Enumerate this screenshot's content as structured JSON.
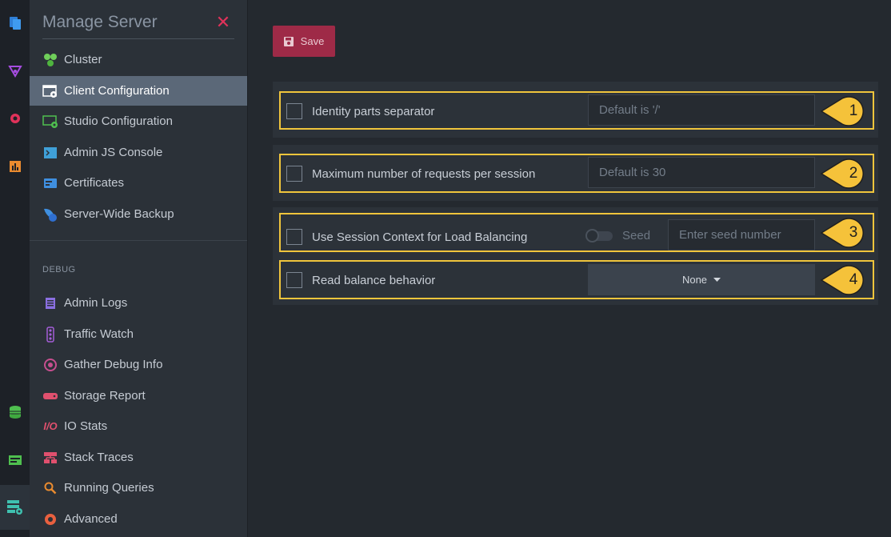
{
  "menu": {
    "title": "Manage Server",
    "items": [
      {
        "label": "Cluster"
      },
      {
        "label": "Client Configuration"
      },
      {
        "label": "Studio Configuration"
      },
      {
        "label": "Admin JS Console"
      },
      {
        "label": "Certificates"
      },
      {
        "label": "Server-Wide Backup"
      }
    ],
    "debug_section": "DEBUG",
    "debug_items": [
      {
        "label": "Admin Logs"
      },
      {
        "label": "Traffic Watch"
      },
      {
        "label": "Gather Debug Info"
      },
      {
        "label": "Storage Report"
      },
      {
        "label": "IO Stats"
      },
      {
        "label": "Stack Traces"
      },
      {
        "label": "Running Queries"
      },
      {
        "label": "Advanced"
      }
    ]
  },
  "toolbar": {
    "save_label": "Save"
  },
  "settings": {
    "identity": {
      "label": "Identity parts separator",
      "placeholder": "Default is '/'",
      "callout": "1"
    },
    "max_requests": {
      "label": "Maximum number of requests per session",
      "placeholder": "Default is 30",
      "callout": "2"
    },
    "session_context": {
      "label": "Use Session Context for Load Balancing",
      "seed_label": "Seed",
      "seed_placeholder": "Enter seed number",
      "callout": "3"
    },
    "read_balance": {
      "label": "Read balance behavior",
      "value": "None",
      "callout": "4"
    }
  },
  "colors": {
    "accent": "#f0c53c",
    "save": "#9e2a47",
    "close": "#e0325a",
    "active_item": "#5b6878"
  }
}
